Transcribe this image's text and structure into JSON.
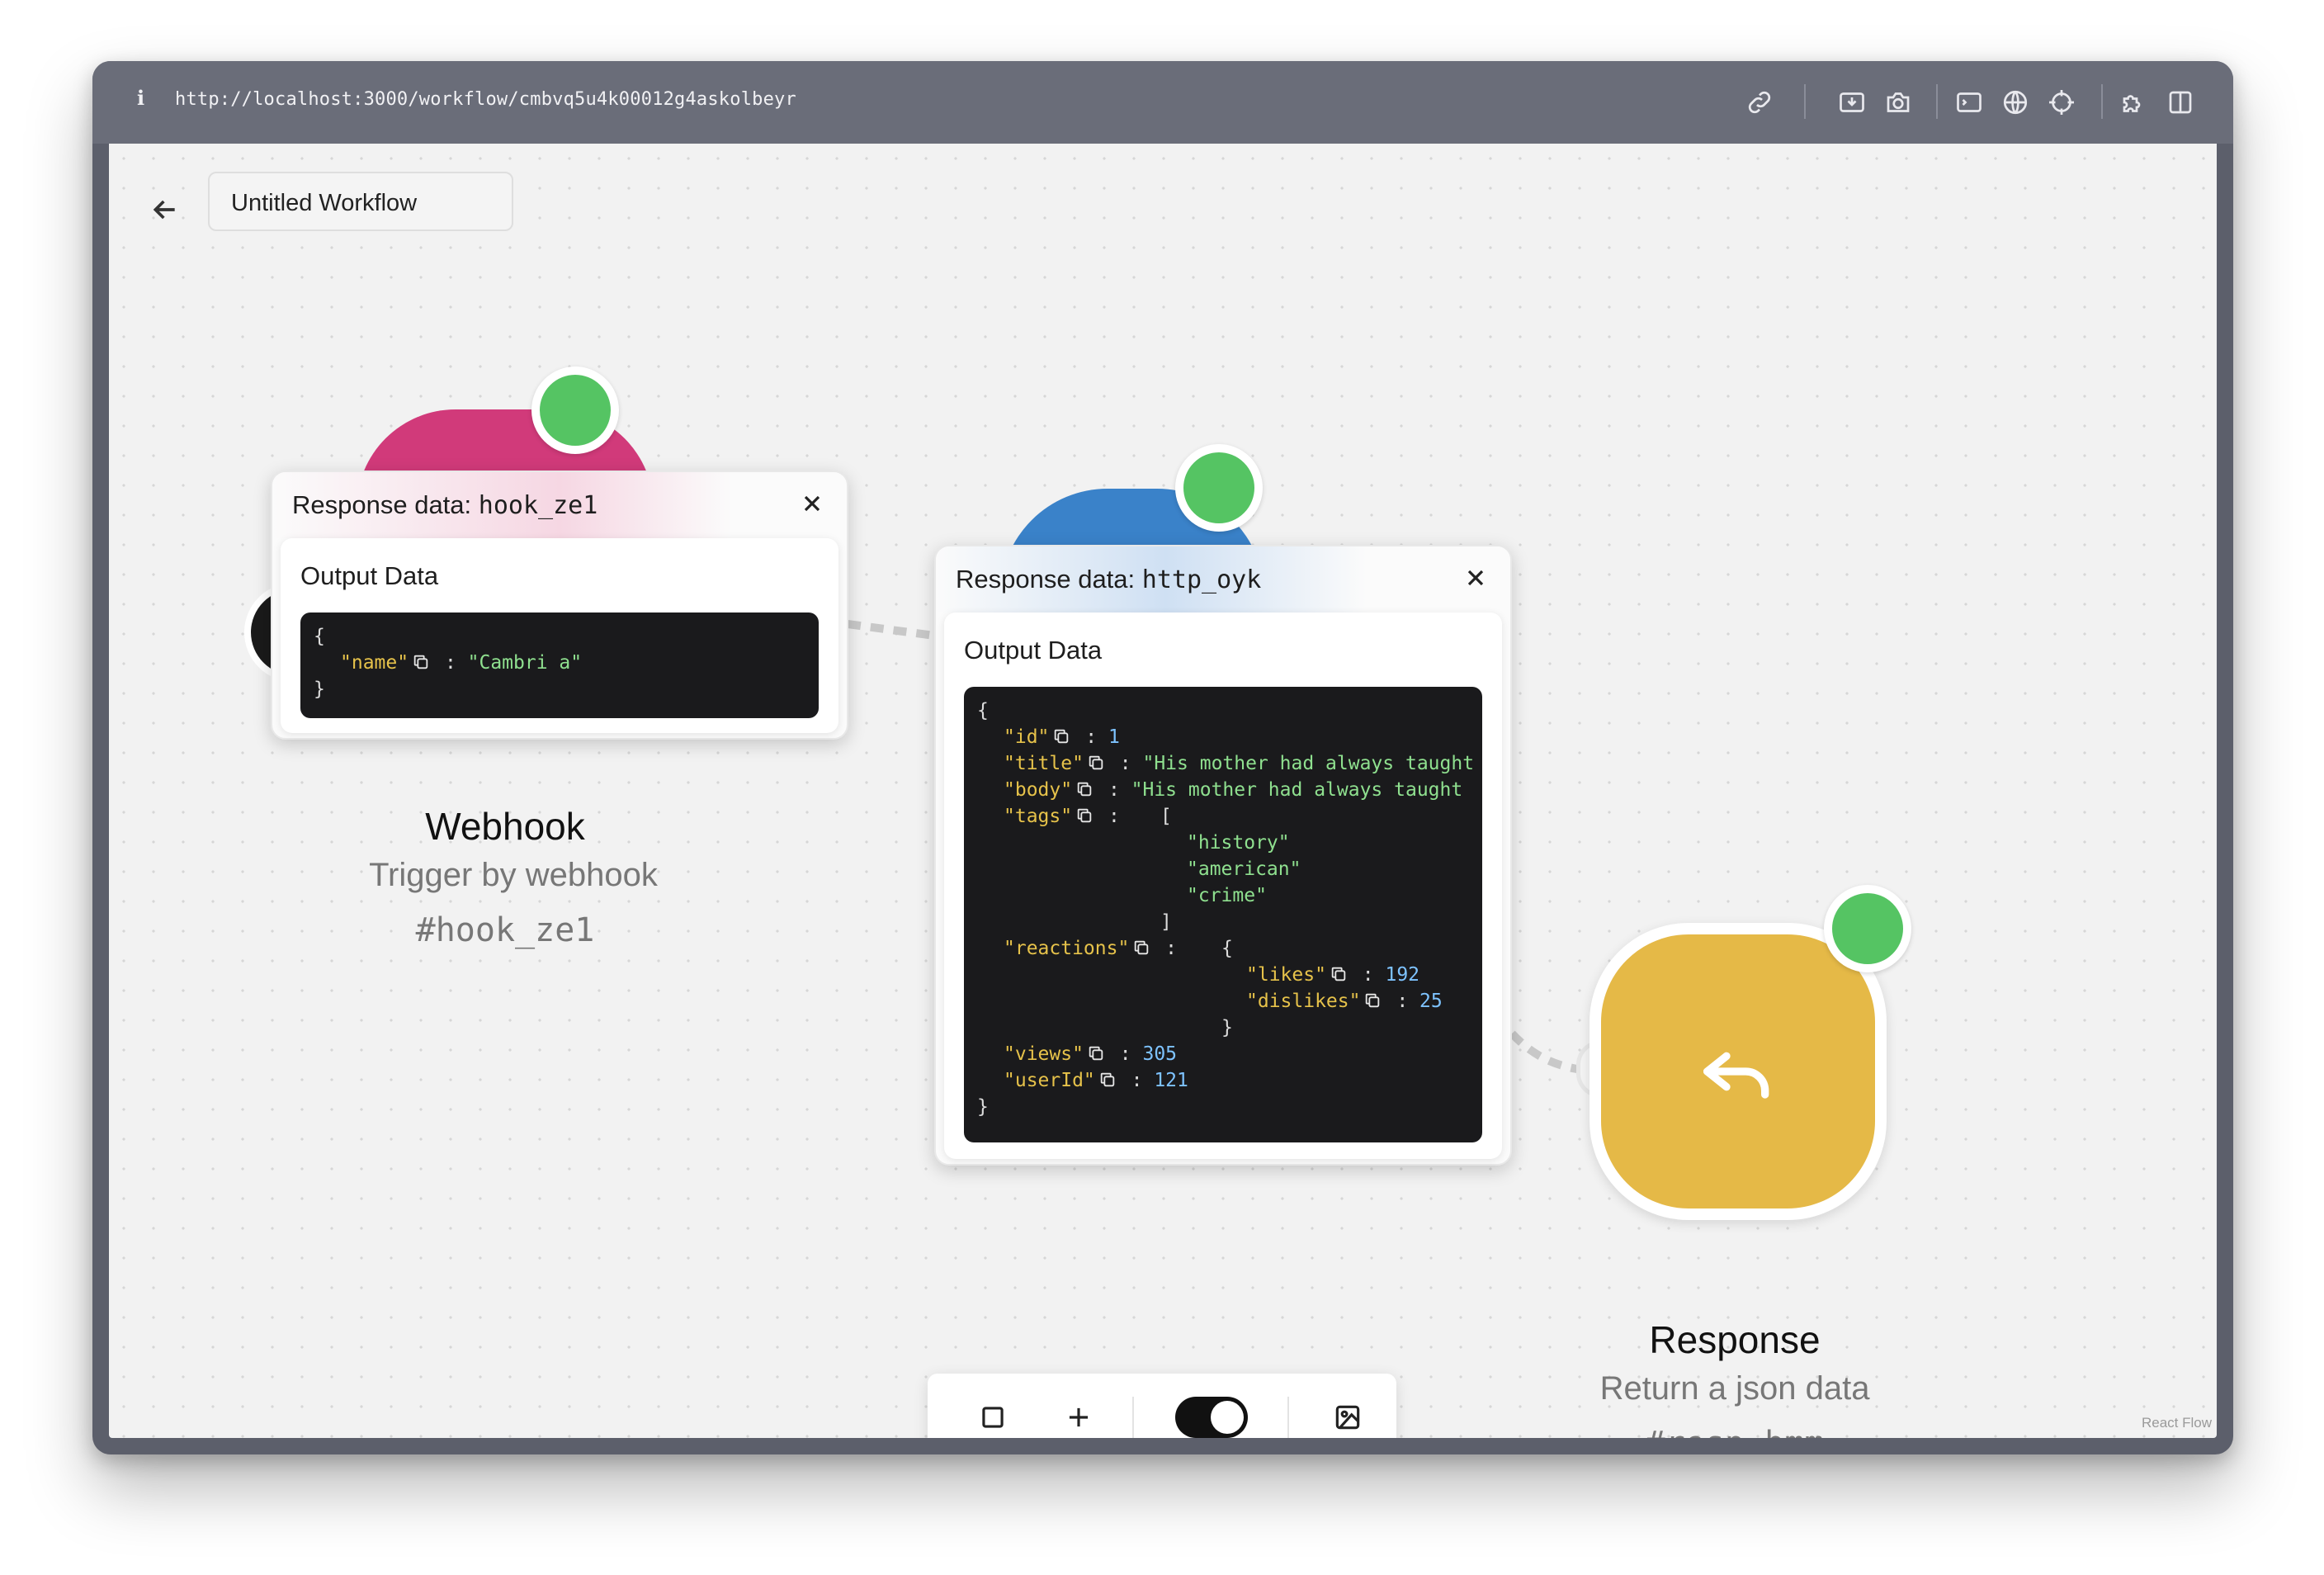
{
  "browser": {
    "info_glyph": "i",
    "url": "http://localhost:3000/workflow/cmbvq5u4k00012g4askolbeyr",
    "icons": [
      "link-icon",
      "screenshot-icon",
      "camera-icon",
      "terminal-icon",
      "globe-icon",
      "crosshair-icon",
      "extension-icon",
      "sidebar-icon"
    ]
  },
  "header": {
    "back_icon": "arrow-left-icon",
    "workflow_title": "Untitled Workflow"
  },
  "nodes": {
    "webhook": {
      "title": "Webhook",
      "subtitle": "Trigger by webhook",
      "id": "#hook_ze1",
      "color": "#d13a7a",
      "status_color": "#55c463"
    },
    "http": {
      "color": "#3a82c9",
      "status_color": "#55c463"
    },
    "response": {
      "title": "Response",
      "subtitle": "Return a json data",
      "id": "#resp_bmm",
      "color": "#e5b947",
      "status_color": "#55c463",
      "icon": "reply-arrow-icon"
    }
  },
  "popups": {
    "webhook": {
      "head_label": "Response data: ",
      "head_id": "hook_ze1",
      "output_title": "Output Data",
      "lines": {
        "l1": "{",
        "l2_key": "\"name\"",
        "l2_sep": " : ",
        "l2_val": "\"Cambri a\"",
        "l3": "}"
      }
    },
    "http": {
      "head_label": "Response data: ",
      "head_id": "http_oyk",
      "output_title": "Output Data",
      "lines": {
        "open": "{",
        "id_key": "\"id\"",
        "id_val": "1",
        "title_key": "\"title\"",
        "title_val": "\"His mother had always taught",
        "body_key": "\"body\"",
        "body_val": "\"His mother had always taught",
        "tags_key": "\"tags\"",
        "tags_open": "[",
        "tag1": "\"history\"",
        "tag2": "\"american\"",
        "tag3": "\"crime\"",
        "tags_close": "]",
        "reactions_key": "\"reactions\"",
        "reactions_open": "{",
        "likes_key": "\"likes\"",
        "likes_val": "192",
        "dislikes_key": "\"dislikes\"",
        "dislikes_val": "25",
        "reactions_close": "}",
        "views_key": "\"views\"",
        "views_val": "305",
        "userId_key": "\"userId\"",
        "userId_val": "121",
        "close": "}",
        "sep": " : "
      }
    }
  },
  "toolbar": {
    "items": [
      "square-icon",
      "plus-icon",
      "toggle",
      "image-icon"
    ],
    "toggle_on": true
  },
  "attribution": "React Flow"
}
